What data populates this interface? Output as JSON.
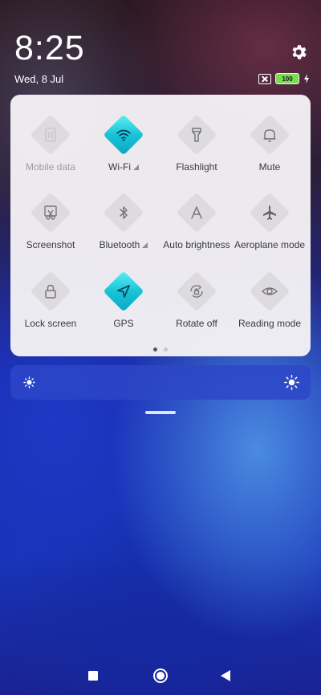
{
  "status": {
    "time": "8:25",
    "date": "Wed, 8 Jul",
    "battery_level": "100",
    "icons": [
      "sim-x-icon",
      "battery-icon",
      "charging-icon",
      "settings-gear-icon"
    ]
  },
  "quick_settings": {
    "tiles": [
      {
        "label": "Mobile data",
        "icon": "mobile-data-icon",
        "active": false,
        "disabled": true,
        "signal_triangle": false
      },
      {
        "label": "Wi-Fi",
        "icon": "wifi-icon",
        "active": true,
        "disabled": false,
        "signal_triangle": true
      },
      {
        "label": "Flashlight",
        "icon": "flashlight-icon",
        "active": false,
        "disabled": false,
        "signal_triangle": false
      },
      {
        "label": "Mute",
        "icon": "bell-icon",
        "active": false,
        "disabled": false,
        "signal_triangle": false
      },
      {
        "label": "Screenshot",
        "icon": "scissors-icon",
        "active": false,
        "disabled": false,
        "signal_triangle": false
      },
      {
        "label": "Bluetooth",
        "icon": "bluetooth-icon",
        "active": false,
        "disabled": false,
        "signal_triangle": true
      },
      {
        "label": "Auto brightness",
        "icon": "auto-brightness-icon",
        "active": false,
        "disabled": false,
        "signal_triangle": false
      },
      {
        "label": "Aeroplane mode",
        "icon": "airplane-icon",
        "active": false,
        "disabled": false,
        "signal_triangle": false
      },
      {
        "label": "Lock screen",
        "icon": "lock-icon",
        "active": false,
        "disabled": false,
        "signal_triangle": false
      },
      {
        "label": "GPS",
        "icon": "location-arrow-icon",
        "active": true,
        "disabled": false,
        "signal_triangle": false
      },
      {
        "label": "Rotate off",
        "icon": "rotate-lock-icon",
        "active": false,
        "disabled": false,
        "signal_triangle": false
      },
      {
        "label": "Reading mode",
        "icon": "eye-icon",
        "active": false,
        "disabled": false,
        "signal_triangle": false
      }
    ],
    "page_count": 2,
    "current_page": 1
  },
  "brightness": {
    "icons": [
      "brightness-low-icon",
      "brightness-high-icon"
    ]
  },
  "colors": {
    "tile_active": "#19c3d6",
    "tile_inactive": "#dedbe0",
    "panel_bg": "#f5f3f6",
    "brightness_bar": "#2d46c8"
  },
  "navbar": {
    "icons": [
      "recent-apps-icon",
      "home-icon",
      "back-icon"
    ]
  }
}
